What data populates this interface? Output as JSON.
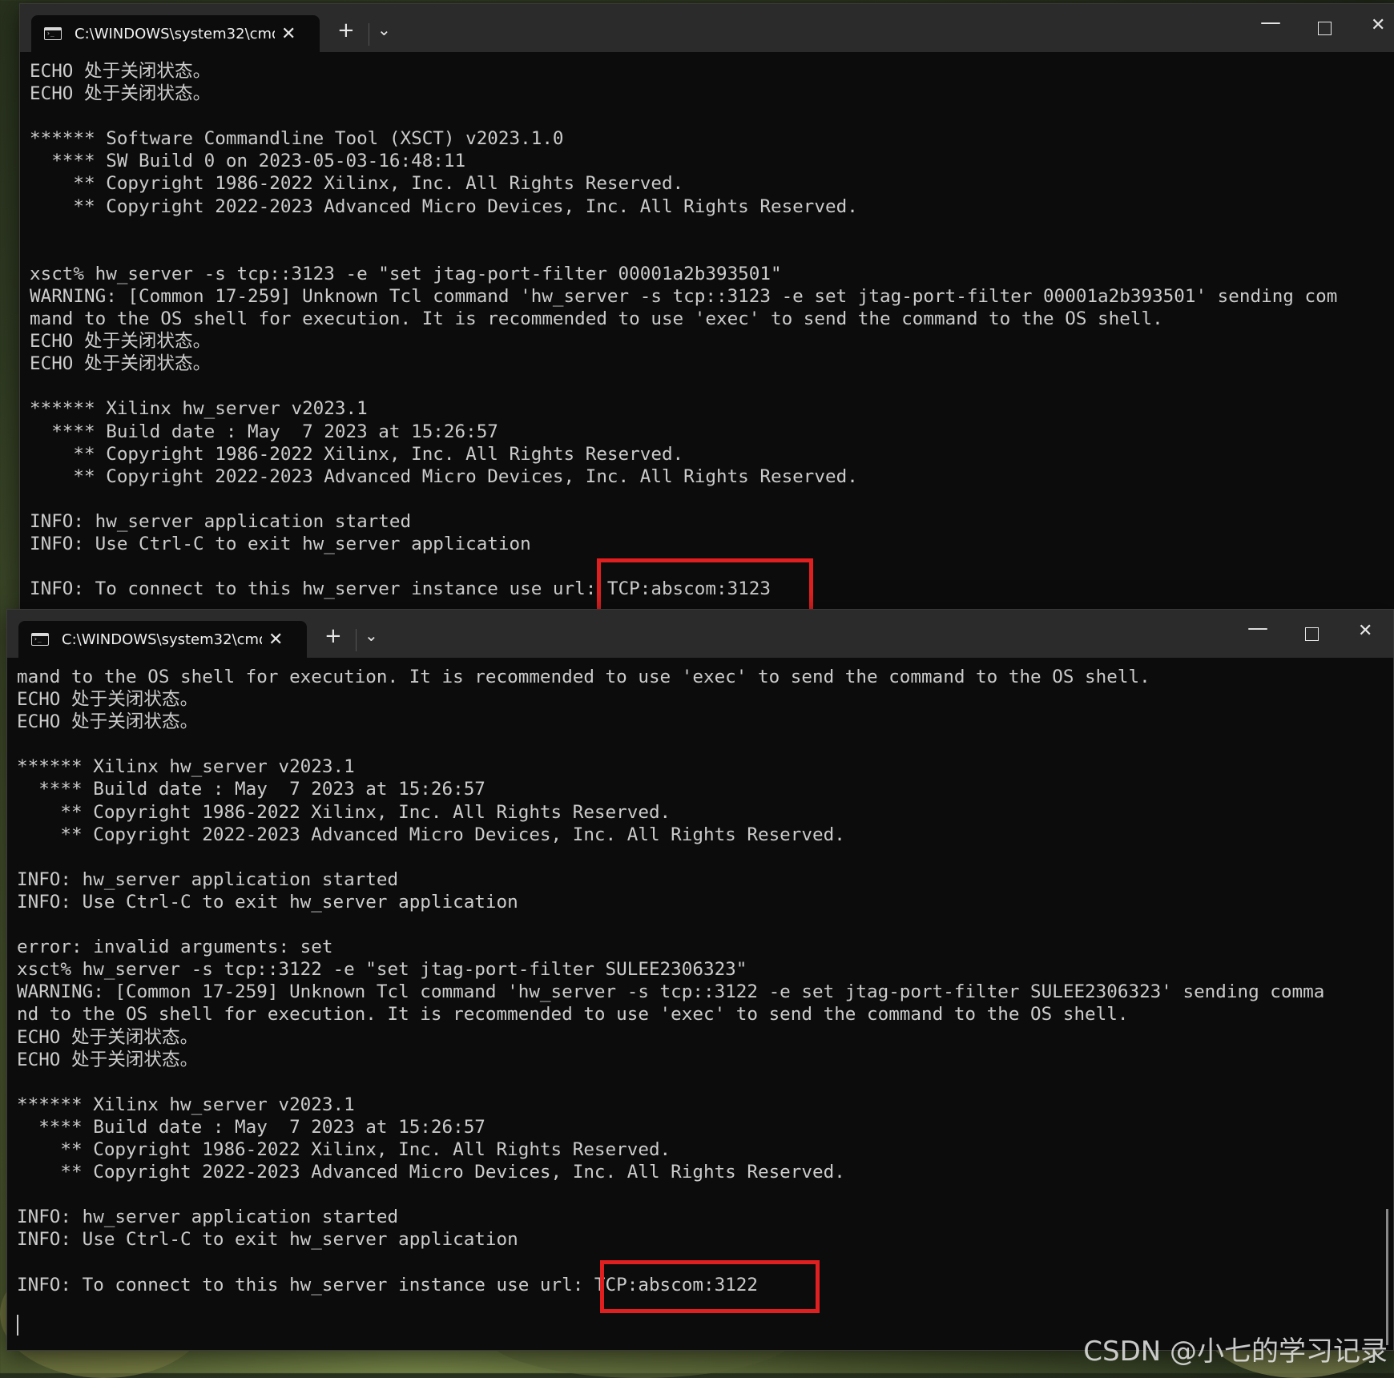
{
  "window1": {
    "tab_title": "C:\\WINDOWS\\system32\\cmd.",
    "new_tab": "+",
    "tab_close": "✕",
    "dropdown": "⌄",
    "minimize": "—",
    "close": "✕",
    "lines": [
      "ECHO 处于关闭状态。",
      "ECHO 处于关闭状态。",
      "",
      "****** Software Commandline Tool (XSCT) v2023.1.0",
      "  **** SW Build 0 on 2023-05-03-16:48:11",
      "    ** Copyright 1986-2022 Xilinx, Inc. All Rights Reserved.",
      "    ** Copyright 2022-2023 Advanced Micro Devices, Inc. All Rights Reserved.",
      "",
      "",
      "xsct% hw_server -s tcp::3123 -e \"set jtag-port-filter 00001a2b393501\"",
      "WARNING: [Common 17-259] Unknown Tcl command 'hw_server -s tcp::3123 -e set jtag-port-filter 00001a2b393501' sending com",
      "mand to the OS shell for execution. It is recommended to use 'exec' to send the command to the OS shell.",
      "ECHO 处于关闭状态。",
      "ECHO 处于关闭状态。",
      "",
      "****** Xilinx hw_server v2023.1",
      "  **** Build date : May  7 2023 at 15:26:57",
      "    ** Copyright 1986-2022 Xilinx, Inc. All Rights Reserved.",
      "    ** Copyright 2022-2023 Advanced Micro Devices, Inc. All Rights Reserved.",
      "",
      "INFO: hw_server application started",
      "INFO: Use Ctrl-C to exit hw_server application",
      "",
      "INFO: To connect to this hw_server instance use url: TCP:abscom:3123"
    ]
  },
  "window2": {
    "tab_title": "C:\\WINDOWS\\system32\\cmd.",
    "new_tab": "+",
    "tab_close": "✕",
    "dropdown": "⌄",
    "minimize": "—",
    "close": "✕",
    "lines": [
      "mand to the OS shell for execution. It is recommended to use 'exec' to send the command to the OS shell.",
      "ECHO 处于关闭状态。",
      "ECHO 处于关闭状态。",
      "",
      "****** Xilinx hw_server v2023.1",
      "  **** Build date : May  7 2023 at 15:26:57",
      "    ** Copyright 1986-2022 Xilinx, Inc. All Rights Reserved.",
      "    ** Copyright 2022-2023 Advanced Micro Devices, Inc. All Rights Reserved.",
      "",
      "INFO: hw_server application started",
      "INFO: Use Ctrl-C to exit hw_server application",
      "",
      "error: invalid arguments: set",
      "xsct% hw_server -s tcp::3122 -e \"set jtag-port-filter SULEE2306323\"",
      "WARNING: [Common 17-259] Unknown Tcl command 'hw_server -s tcp::3122 -e set jtag-port-filter SULEE2306323' sending comma",
      "nd to the OS shell for execution. It is recommended to use 'exec' to send the command to the OS shell.",
      "ECHO 处于关闭状态。",
      "ECHO 处于关闭状态。",
      "",
      "****** Xilinx hw_server v2023.1",
      "  **** Build date : May  7 2023 at 15:26:57",
      "    ** Copyright 1986-2022 Xilinx, Inc. All Rights Reserved.",
      "    ** Copyright 2022-2023 Advanced Micro Devices, Inc. All Rights Reserved.",
      "",
      "INFO: hw_server application started",
      "INFO: Use Ctrl-C to exit hw_server application",
      "",
      "INFO: To connect to this hw_server instance use url: TCP:abscom:3122"
    ]
  },
  "watermark": "CSDN @小七的学习记录",
  "colors": {
    "console_bg": "#0c0c0c",
    "console_text": "#cccccc",
    "titlebar_bg": "#2b2b2b",
    "highlight_box": "#e02020"
  }
}
